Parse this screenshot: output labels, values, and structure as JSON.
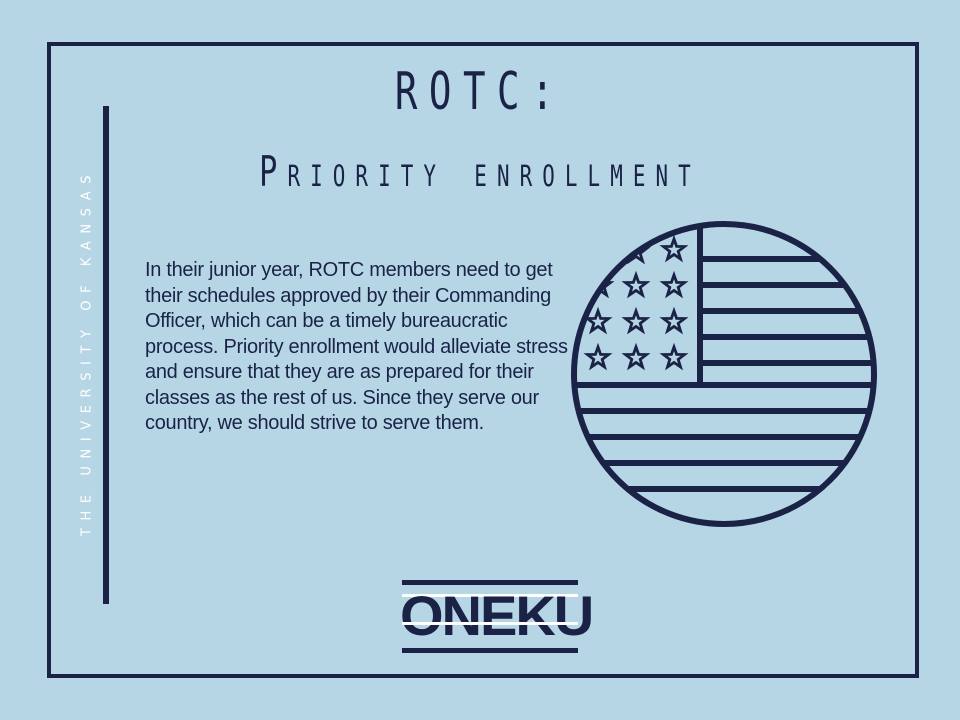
{
  "side_text": "THE UNIVERSITY OF KANSAS",
  "title": "ROTC:",
  "subtitle": "Priority enrollment",
  "body": "In their junior year, ROTC members need to get their schedules approved by their Commanding Officer, which can be a timely bureaucratic process. Priority enrollment would alleviate stress and ensure that they are as prepared for their classes as the rest of us. Since they serve our country, we should strive to serve them.",
  "logo_text": "ONEKU",
  "colors": {
    "background": "#b6d6e6",
    "navy": "#1a2246",
    "white": "#ffffff"
  },
  "icons": [
    "american-flag-circle-icon"
  ]
}
